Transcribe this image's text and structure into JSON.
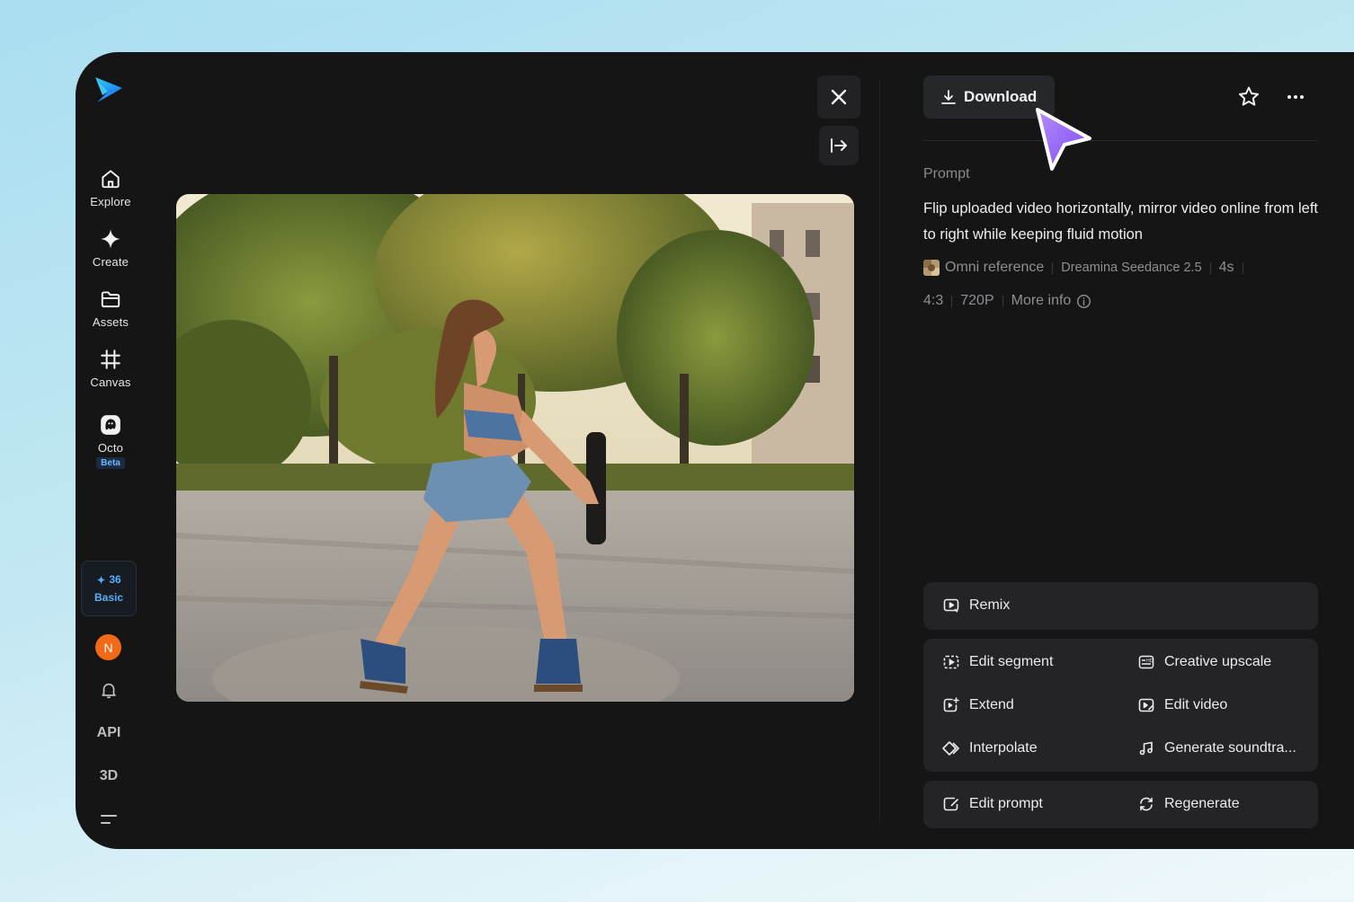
{
  "sidebar": {
    "nav": [
      {
        "label": "Explore",
        "icon": "home-icon"
      },
      {
        "label": "Create",
        "icon": "sparkle-icon"
      },
      {
        "label": "Assets",
        "icon": "folder-icon"
      },
      {
        "label": "Canvas",
        "icon": "crop-icon"
      },
      {
        "label": "Octo",
        "icon": "octo-icon",
        "badge": "Beta"
      }
    ],
    "credits": {
      "count": "36",
      "plan": "Basic"
    },
    "avatar_initial": "N",
    "api_label": "API",
    "three_d_label": "3D"
  },
  "viewer": {
    "close_icon": "close-icon",
    "expand_icon": "collapse-panel-icon"
  },
  "panel": {
    "download_label": "Download",
    "prompt_label": "Prompt",
    "prompt_text": "Flip uploaded video horizontally, mirror video online from left to right while keeping fluid motion",
    "meta": {
      "reference": "Omni reference",
      "model": "Dreamina Seedance 2.5",
      "duration": "4s",
      "aspect": "4:3",
      "resolution": "720P",
      "more_info": "More info"
    },
    "remix_label": "Remix",
    "tools": [
      {
        "label": "Edit segment",
        "icon": "edit-segment-icon"
      },
      {
        "label": "Creative upscale",
        "icon": "upscale-icon"
      },
      {
        "label": "Extend",
        "icon": "extend-icon"
      },
      {
        "label": "Edit video",
        "icon": "edit-video-icon"
      },
      {
        "label": "Interpolate",
        "icon": "interpolate-icon"
      },
      {
        "label": "Generate soundtra...",
        "icon": "music-note-icon"
      }
    ],
    "edit_prompt_label": "Edit prompt",
    "regenerate_label": "Regenerate"
  },
  "colors": {
    "accent_cursor": "#9b6cf6",
    "credits_blue": "#5aaef7",
    "avatar_orange": "#f06a18",
    "panel_bg": "#151516"
  }
}
